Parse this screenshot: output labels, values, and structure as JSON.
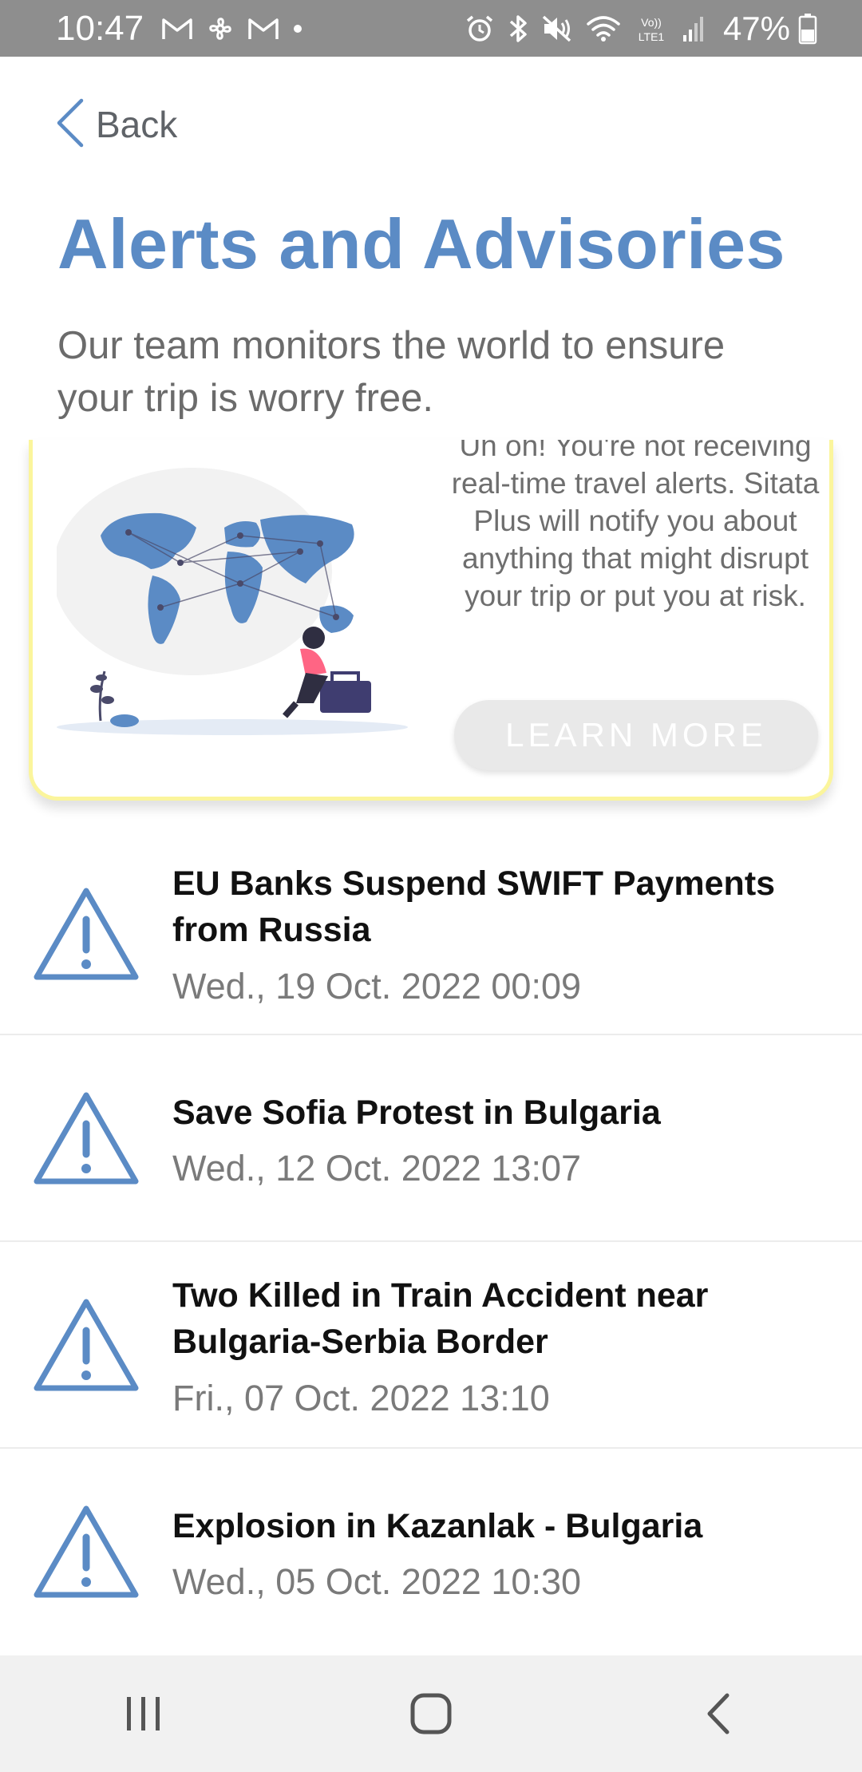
{
  "status_bar": {
    "time": "10:47",
    "battery": "47%",
    "left_icons": [
      "gmail-icon",
      "fan-icon",
      "gmail-icon",
      "dot-icon"
    ],
    "right_icons": [
      "alarm-icon",
      "bluetooth-icon",
      "mute-icon",
      "wifi-icon",
      "volte-icon",
      "signal-icon",
      "battery-icon"
    ]
  },
  "header": {
    "back_label": "Back",
    "title": "Alerts and Advisories",
    "subtitle": "Our team monitors the world to ensure your trip is worry free."
  },
  "promo": {
    "text": "Uh oh! You're not receiving real-time travel alerts. Sitata Plus will notify you about anything that might disrupt your trip or put you at risk.",
    "button_label": "LEARN MORE"
  },
  "alerts": [
    {
      "title": "EU Banks Suspend SWIFT Payments from Russia",
      "date": "Wed., 19 Oct. 2022 00:09"
    },
    {
      "title": "Save Sofia Protest in Bulgaria",
      "date": "Wed., 12 Oct. 2022 13:07"
    },
    {
      "title": "Two Killed in Train Accident near Bulgaria-Serbia Border",
      "date": "Fri., 07 Oct. 2022 13:10"
    },
    {
      "title": "Explosion in Kazanlak - Bulgaria",
      "date": "Wed., 05 Oct. 2022 10:30"
    }
  ],
  "colors": {
    "accent": "#5b8bc5",
    "status_bar": "#8e8e8e",
    "promo_border": "#fbf59c",
    "button_bg": "#e9e9e9"
  }
}
